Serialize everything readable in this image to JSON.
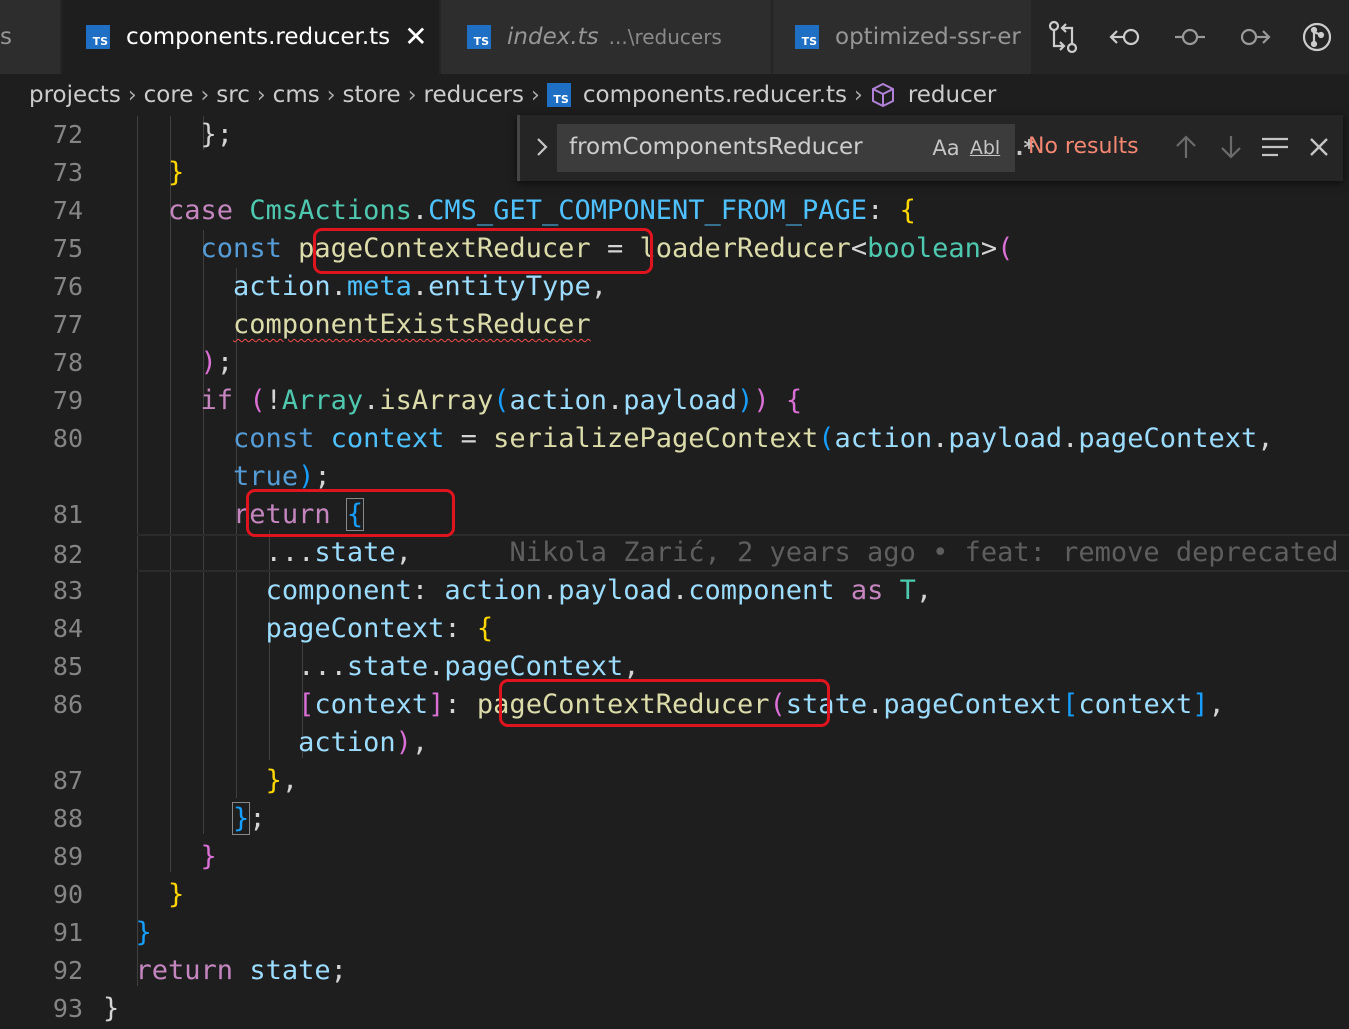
{
  "tabs": [
    {
      "label": "s"
    },
    {
      "label": "components.reducer.ts",
      "close": "✕"
    },
    {
      "label": "index.ts",
      "description": "...\\reducers"
    },
    {
      "label": "optimized-ssr-er"
    }
  ],
  "ts_badge": "TS",
  "breadcrumb": [
    "projects",
    "core",
    "src",
    "cms",
    "store",
    "reducers",
    "components.reducer.ts",
    "reducer"
  ],
  "breadcrumb_separator": "›",
  "find": {
    "query": "fromComponentsReducer",
    "toggle": "›",
    "match_case": "Aa",
    "whole_word": "Abl",
    "regex": ".*",
    "status": "No results"
  },
  "line_numbers": [
    "72",
    "73",
    "74",
    "75",
    "76",
    "77",
    "78",
    "79",
    "80",
    "",
    "81",
    "82",
    "83",
    "84",
    "85",
    "86",
    "",
    "87",
    "88",
    "89",
    "90",
    "91",
    "92",
    "93"
  ],
  "code": {
    "l72": {
      "a": "      ",
      "b": "};"
    },
    "l73": {
      "a": "    ",
      "b": "}"
    },
    "l74": {
      "indent": "    ",
      "kw": "case",
      "sp1": " ",
      "obj": "CmsActions",
      "dot": ".",
      "const": "CMS_GET_COMPONENT_FROM_PAGE",
      "colon": ": ",
      "brace": "{"
    },
    "l75": {
      "indent": "      ",
      "kw": "const",
      "sp1": " ",
      "name": "pageContextReducer",
      "eq": " = ",
      "fn": "loaderReducer",
      "lt": "<",
      "ty": "boolean",
      "gt": ">",
      "paren": "("
    },
    "l76": {
      "indent": "        ",
      "v1": "action",
      "d1": ".",
      "v2": "meta",
      "d2": ".",
      "v3": "entityType",
      "comma": ","
    },
    "l77": {
      "indent": "        ",
      "fn": "componentExistsReducer"
    },
    "l78": {
      "indent": "      ",
      "paren": ")",
      "semi": ";"
    },
    "l79": {
      "indent": "      ",
      "kw": "if",
      "sp": " ",
      "p1": "(",
      "bang": "!",
      "ty": "Array",
      "dot": ".",
      "fn": "isArray",
      "p2": "(",
      "v1": "action",
      "d1": ".",
      "v2": "payload",
      "p3": ")",
      "p4": ")",
      "sp2": " ",
      "brace": "{"
    },
    "l80": {
      "indent": "        ",
      "kw": "const",
      "sp": " ",
      "v1": "context",
      "eq": " = ",
      "fn": "serializePageContext",
      "p": "(",
      "v2": "action",
      "d1": ".",
      "v3": "payload",
      "d2": ".",
      "v4": "pageContext",
      "comma": ","
    },
    "l80b": {
      "indent": "        ",
      "kw": "true",
      "p": ")",
      "semi": ";"
    },
    "l81": {
      "indent": "        ",
      "kw": "return",
      "sp": " ",
      "brace": "{"
    },
    "l82": {
      "indent": "          ",
      "text": "...",
      "v": "state",
      "comma": ",",
      "gap": "      ",
      "blame": "Nikola Zarić, 2 years ago • feat: remove deprecated"
    },
    "l83": {
      "indent": "          ",
      "v1": "component",
      "colon": ": ",
      "v2": "action",
      "d1": ".",
      "v3": "payload",
      "d2": ".",
      "v4": "component",
      "sp": " ",
      "kw": "as",
      "sp2": " ",
      "ty": "T",
      "comma": ","
    },
    "l84": {
      "indent": "          ",
      "v": "pageContext",
      "colon": ": ",
      "brace": "{"
    },
    "l85": {
      "indent": "            ",
      "text": "...",
      "v1": "state",
      "d": ".",
      "v2": "pageContext",
      "comma": ","
    },
    "l86": {
      "indent": "            ",
      "b1": "[",
      "v1": "context",
      "b2": "]",
      "colon": ": ",
      "fn": "pageContextReducer",
      "p": "(",
      "v2": "state",
      "d": ".",
      "v3": "pageContext",
      "b3": "[",
      "v4": "context",
      "b4": "]",
      "comma": ","
    },
    "l86b": {
      "indent": "            ",
      "v": "action",
      "p": ")",
      "comma": ","
    },
    "l87": {
      "indent": "          ",
      "brace": "}",
      "comma": ","
    },
    "l88": {
      "indent": "        ",
      "brace": "}",
      "semi": ";"
    },
    "l89": {
      "indent": "      ",
      "brace": "}"
    },
    "l90": {
      "indent": "    ",
      "brace": "}"
    },
    "l91": {
      "indent": "  ",
      "brace": "}"
    },
    "l92": {
      "indent": "  ",
      "kw": "return",
      "sp": " ",
      "v": "state",
      "semi": ";"
    },
    "l93": {
      "brace": "}"
    }
  },
  "colors": {
    "background": "#1e1e1e",
    "tab_bar": "#252526",
    "highlight_box": "#e0141f",
    "ts_badge": "#1f6fc5",
    "find_status": "#f48771"
  }
}
